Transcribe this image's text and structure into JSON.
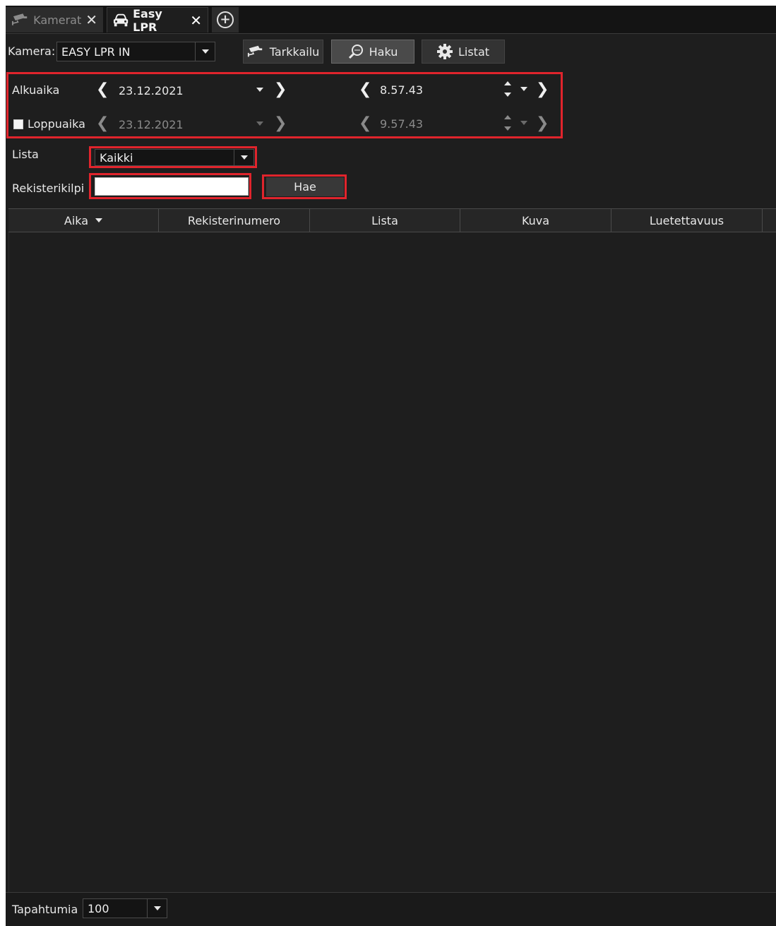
{
  "tabs": [
    {
      "label": "Kamerat",
      "icon": "cctv-camera-icon"
    },
    {
      "label": "Easy LPR",
      "icon": "car-icon"
    }
  ],
  "toolbar": {
    "camera_label": "Kamera:",
    "camera_value": "EASY LPR IN",
    "buttons": [
      {
        "label": "Tarkkailu",
        "icon": "cctv-camera-icon"
      },
      {
        "label": "Haku",
        "icon": "search-icon"
      },
      {
        "label": "Listat",
        "icon": "gear-icon"
      }
    ]
  },
  "search": {
    "start_label": "Alkuaika",
    "start_date": "23.12.2021",
    "start_time": "8.57.43",
    "end_label": "Loppuaika",
    "end_date": "23.12.2021",
    "end_time": "9.57.43",
    "list_label": "Lista",
    "list_value": "Kaikki",
    "plate_label": "Rekisterikilpi",
    "plate_value": "",
    "search_button": "Hae"
  },
  "table": {
    "columns": [
      "Aika",
      "Rekisterinumero",
      "Lista",
      "Kuva",
      "Luetettavuus"
    ],
    "rows": []
  },
  "footer": {
    "events_label": "Tapahtumia",
    "events_value": "100"
  },
  "colors": {
    "background": "#1e1e1e",
    "highlight": "#e0242c"
  }
}
